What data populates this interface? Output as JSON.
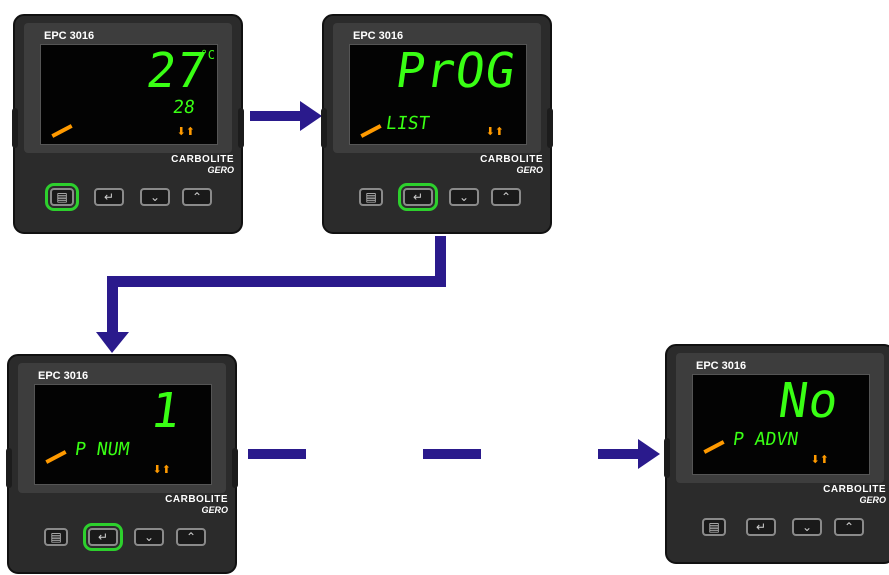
{
  "controllers": [
    {
      "model": "EPC 3016",
      "main": "27",
      "unit": "°C",
      "sub": "28",
      "brand1": "CARBOLITE",
      "brand2": "GERO",
      "highlight": "page"
    },
    {
      "model": "EPC 3016",
      "main": "PrOG",
      "unit": "",
      "sub": "LIST",
      "brand1": "CARBOLITE",
      "brand2": "GERO",
      "highlight": "enter"
    },
    {
      "model": "EPC 3016",
      "main": "1",
      "unit": "",
      "sub": "P NUM",
      "brand1": "CARBOLITE",
      "brand2": "GERO",
      "highlight": "enter"
    },
    {
      "model": "EPC 3016",
      "main": "No",
      "unit": "",
      "sub": "P ADVN",
      "brand1": "CARBOLITE",
      "brand2": "GERO",
      "highlight": "none"
    }
  ],
  "icons": {
    "page": "page-icon",
    "enter": "enter-icon",
    "down": "chevron-down-icon",
    "up": "chevron-up-icon",
    "status": "up-down-arrows-icon"
  },
  "colors": {
    "display_text": "#39ff14",
    "highlight": "#2dd02d",
    "arrow": "#2a1a8c",
    "ramp": "#ff9a00"
  }
}
